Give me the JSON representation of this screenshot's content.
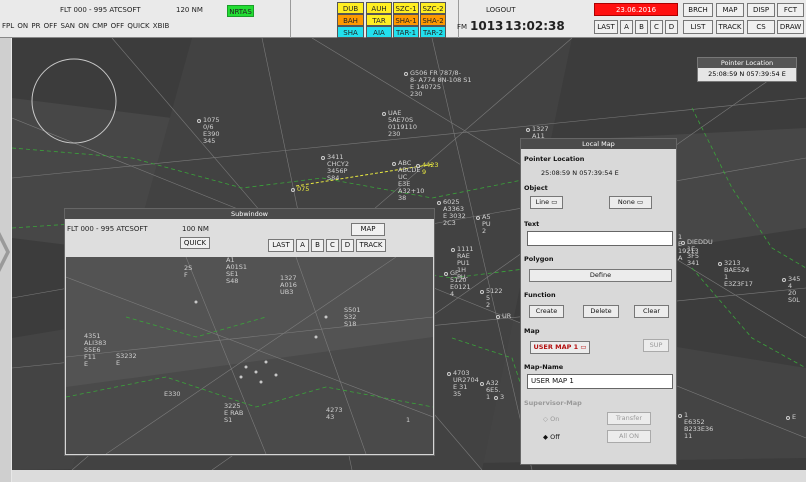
{
  "topbar": {
    "filter_range": "FLT 000 - 995 ATCSOFT",
    "range": "120 NM",
    "nrtas": "NRTAS",
    "toggles": "FPL ON PR OFF SAN ON CMP OFF QUICK XBIB",
    "tile_labels": [
      "DUB",
      "AUH",
      "SZC-1",
      "SZC-2",
      "BAH",
      "TAR",
      "SHA-1",
      "SHA-2",
      "SHA",
      "AIA",
      "TAR-1",
      "TAR-2"
    ],
    "logout": "LOGOUT",
    "qnh_label": "FM",
    "qnh": "1013",
    "time": "13:02:38",
    "date": "23.06.2016",
    "buttons_row1": [
      "BRCH",
      "MAP",
      "DISP",
      "FCT"
    ],
    "buttons_row2_left": [
      "LAST",
      "A",
      "B",
      "C",
      "D"
    ],
    "buttons_row2_right": [
      "LIST",
      "TRACK",
      "CS",
      "DRAW"
    ],
    "colors": {
      "green": "#22dd33",
      "orange": "#ff9900",
      "red": "#ff1010",
      "cyan": "#22e0ee",
      "yellow": "#ffee22"
    }
  },
  "pointer_location": {
    "title": "Pointer Location",
    "value": "25:08:59 N  057:39:54 E"
  },
  "subwindow": {
    "title": "Subwindow",
    "filter": "FLT 000 - 995 ATCSOFT",
    "range": "100 NM",
    "quick": "QUICK",
    "map": "MAP",
    "track": "TRACK",
    "buttons": [
      "LAST",
      "A",
      "B",
      "C",
      "D"
    ]
  },
  "local_map": {
    "title": "Local Map",
    "pointer_label": "Pointer Location",
    "pointer_value": "25:08:59 N  057:39:54 E",
    "object_label": "Object",
    "object_select": "Line",
    "object_select2": "None",
    "text_label": "Text",
    "text_value": "",
    "polygon_label": "Polygon",
    "define": "Define",
    "function_label": "Function",
    "create": "Create",
    "delete": "Delete",
    "clear": "Clear",
    "map_label": "Map",
    "map_select": "USER MAP 1",
    "sup": "SUP",
    "mapname_label": "Map-Name",
    "mapname_value": "USER MAP 1",
    "supervisor_label": "Supervisor-Map",
    "on": "On",
    "off": "Off",
    "transfer": "Transfer",
    "all_on": "All ON"
  },
  "tracks": [
    {
      "lines": [
        "G506  FR 787/8-",
        "8-  A774 8N-108 S1",
        "E 140725",
        "230"
      ]
    },
    {
      "lines": [
        "1075",
        "0/6",
        "E390",
        "345"
      ]
    },
    {
      "lines": [
        "UAE",
        "5AE70S",
        "0119110",
        "230"
      ]
    },
    {
      "lines": [
        "1327",
        "A11"
      ]
    },
    {
      "lines": [
        "3411",
        "CHCY2",
        "3456P",
        "S84"
      ]
    },
    {
      "lines": [
        "ABC",
        "ABCDE",
        "UC",
        "E3E",
        "A32+10",
        "38"
      ]
    },
    {
      "lines": [
        "6025",
        "A3363",
        "E 3032",
        "2C3"
      ]
    },
    {
      "lines": [
        "A5",
        "PU",
        "2"
      ]
    },
    {
      "lines": [
        "1111",
        "RAE",
        "PU1",
        "1H",
        "PU-"
      ]
    },
    {
      "lines": [
        "P3",
        "A8",
        "1"
      ]
    },
    {
      "lines": [
        "GF",
        "5120",
        "E0121",
        "4"
      ]
    },
    {
      "lines": [
        "5122",
        "5",
        "2"
      ]
    },
    {
      "lines": [
        "UR"
      ]
    },
    {
      "lines": [
        "4703",
        "UR2704",
        "E 31",
        "35"
      ]
    },
    {
      "lines": [
        "A32",
        "6E5.",
        "1"
      ]
    },
    {
      "lines": [
        "3"
      ]
    },
    {
      "lines": [
        "KF",
        "1E",
        "3F",
        "33"
      ]
    },
    {
      "lines": [
        "3213",
        "BAE524",
        "1",
        "E3Z3F17"
      ]
    },
    {
      "lines": [
        "345",
        "4",
        "20",
        "S0L"
      ]
    },
    {
      "lines": [
        "DIEDDU",
        "1E",
        "3F5",
        "341"
      ]
    },
    {
      "lines": [
        "1",
        "E",
        "19213",
        "A"
      ]
    },
    {
      "lines": [
        "1",
        "E6352",
        "B233E36",
        "11"
      ]
    },
    {
      "lines": [
        "E"
      ]
    },
    {
      "lines": [
        "075"
      ]
    },
    {
      "lines": [
        "4423",
        "9"
      ]
    }
  ],
  "sub_tracks": [
    {
      "lines": [
        "A1",
        "A01S1",
        "SE1",
        "S48"
      ]
    },
    {
      "lines": [
        "2S",
        "F"
      ]
    },
    {
      "lines": [
        "1327",
        "A016",
        "UB3"
      ]
    },
    {
      "lines": [
        "S501",
        "S32",
        "S18"
      ]
    },
    {
      "lines": [
        "4351",
        "ALI383",
        "S5E6",
        "F11",
        "E"
      ]
    },
    {
      "lines": [
        "S3232",
        "E"
      ]
    },
    {
      "lines": [
        "3225",
        "E RAB",
        "S1"
      ]
    },
    {
      "lines": [
        "4273",
        "43"
      ]
    },
    {
      "lines": [
        "E330"
      ]
    },
    {
      "lines": [
        "1"
      ]
    }
  ]
}
